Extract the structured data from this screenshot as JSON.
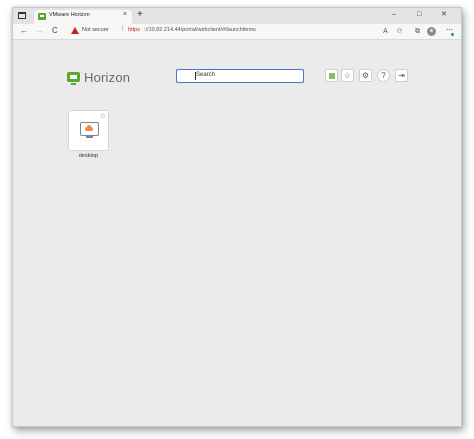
{
  "browser": {
    "tab_title": "VMware Horizon",
    "tab_close": "×",
    "new_tab": "+",
    "window_controls": {
      "minimize": "–",
      "maximize": "□",
      "close": "✕"
    },
    "nav": {
      "back": "←",
      "forward": "→",
      "reload": "C"
    },
    "security_label": "Not secure",
    "separator": "|",
    "url_scheme": "https",
    "url_rest": "://10.82.214.44/portal/webclient/#/launchitems",
    "toolbar_icons": [
      "read-aloud-icon",
      "favorites-icon",
      "collections-icon",
      "profile-icon",
      "extensions-icon"
    ]
  },
  "header": {
    "logo_text": "Horizon",
    "search_placeholder": "Search",
    "buttons": [
      "apps-grid-icon",
      "favorites-star-icon",
      "settings-gear-icon",
      "help-icon",
      "logout-icon"
    ],
    "glyphs": {
      "star": "☆",
      "gear": "⚙",
      "help": "?",
      "logout": "⇥"
    }
  },
  "apps": [
    {
      "label": "desktop",
      "favorite": false
    }
  ],
  "colors": {
    "brand_green": "#5aa832",
    "search_border": "#3f79c7",
    "warning_red": "#c5221f",
    "page_bg": "#ebebeb"
  }
}
